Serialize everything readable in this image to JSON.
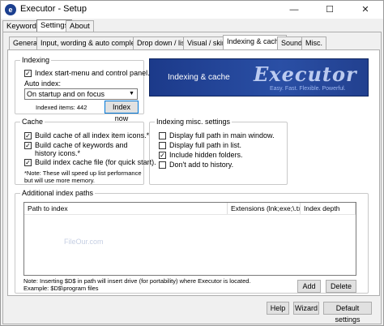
{
  "window": {
    "title": "Executor - Setup",
    "icon_glyph": "e",
    "minimize_glyph": "—",
    "maximize_glyph": "☐",
    "close_glyph": "✕"
  },
  "main_tabs": [
    "Keywords",
    "Settings",
    "About"
  ],
  "sub_tabs": [
    "General",
    "Input, wording & auto completion",
    "Drop down / list",
    "Visual / skin",
    "Indexing & cache",
    "Sound",
    "Misc."
  ],
  "indexing": {
    "title": "Indexing",
    "start_menu_label": "Index start-menu and control panel.",
    "start_menu_checked": true,
    "auto_index_label": "Auto index:",
    "auto_index_value": "On startup and on focus",
    "indexed_items": "Indexed items: 442",
    "index_now_label": "Index now"
  },
  "banner": {
    "text": "Indexing & cache",
    "logo": "Executor",
    "slogan": "Easy. Fast. Flexible. Powerful."
  },
  "cache": {
    "title": "Cache",
    "items": [
      {
        "label": "Build cache of all index item icons.*",
        "checked": true
      },
      {
        "label": "Build cache of keywords and history icons.*",
        "checked": true
      },
      {
        "label": "Build index cache file (for quick start).",
        "checked": true
      }
    ],
    "note": "*Note: These will speed up list performance but will use more memory."
  },
  "misc": {
    "title": "Indexing misc. settings",
    "items": [
      {
        "label": "Display full path in main window.",
        "checked": false
      },
      {
        "label": "Display full path in list.",
        "checked": false
      },
      {
        "label": "Include hidden folders.",
        "checked": true
      },
      {
        "label": "Don't add to history.",
        "checked": false
      }
    ]
  },
  "paths": {
    "title": "Additional index paths",
    "columns": [
      "Path to index",
      "Extensions (lnk;exe;\\.txt)",
      "Index depth"
    ],
    "watermark": "FileOur.com",
    "note_line1": "Note: Inserting $D$ in path will insert drive (for portability) where Executor is located.",
    "note_line2": "Example: $D$\\program files",
    "add_label": "Add",
    "delete_label": "Delete"
  },
  "footer": {
    "help_label": "Help",
    "wizard_label": "Wizard",
    "default_label": "Default settings"
  },
  "colors": {
    "banner": "#1c3a8a",
    "accent": "#0078d7"
  }
}
